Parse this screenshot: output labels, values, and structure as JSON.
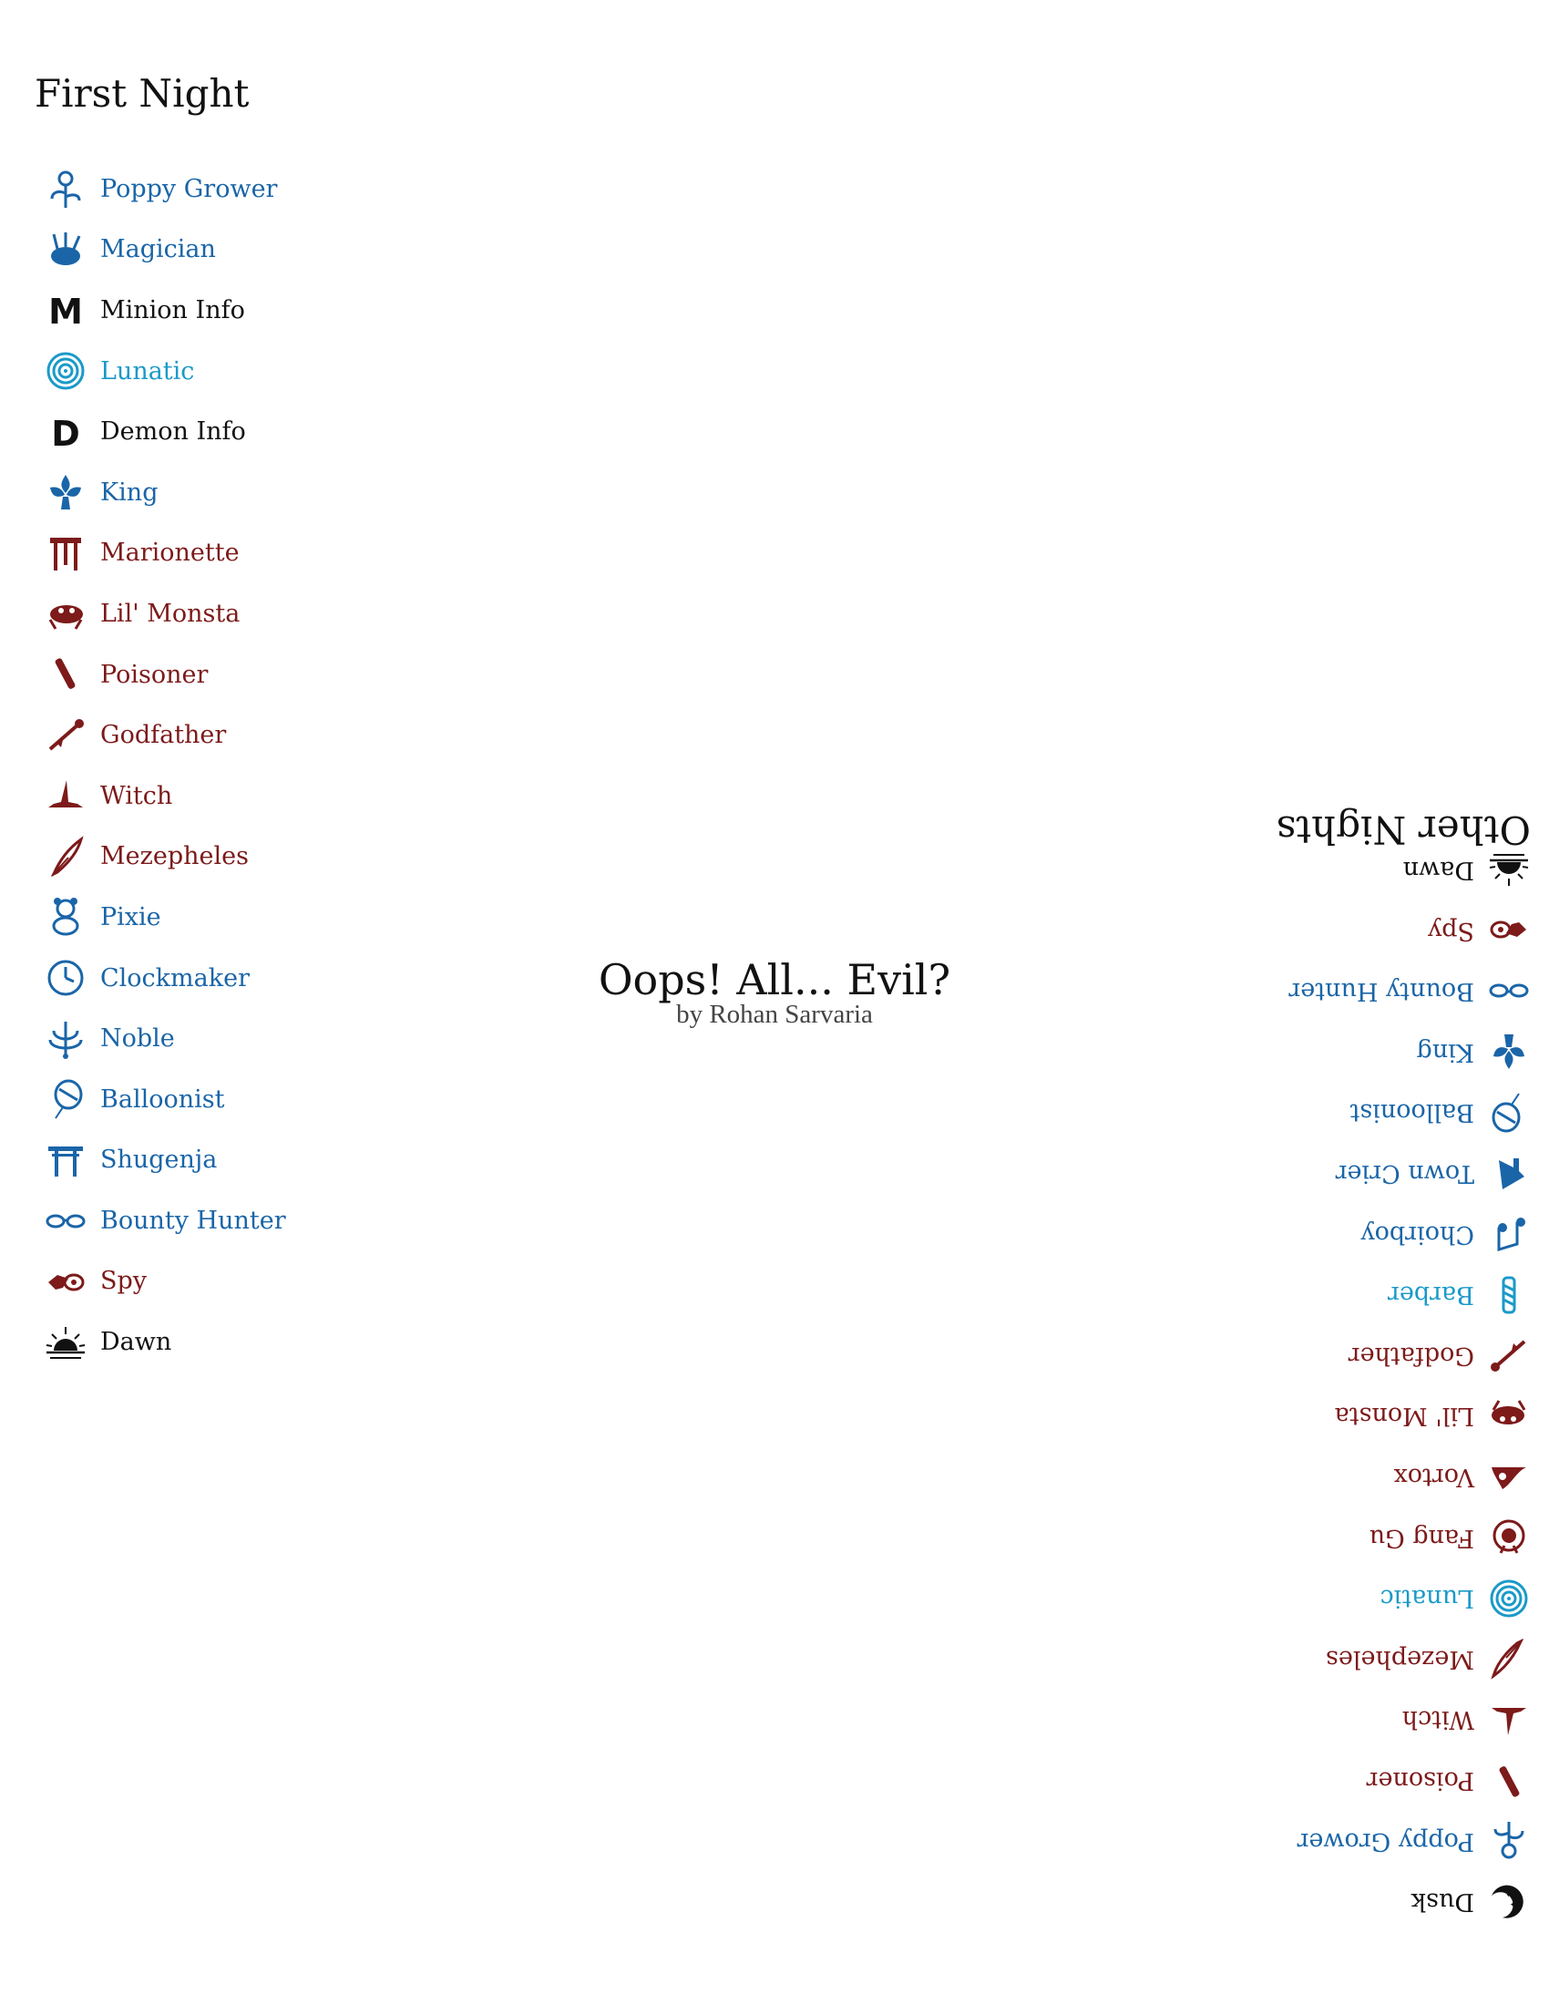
{
  "script": {
    "name": "Oops! All... Evil?",
    "author": "by Rohan Sarvaria"
  },
  "first_night": {
    "title": "First Night",
    "items": [
      {
        "label": "Poppy Grower",
        "team": "good",
        "icon": "poppy-grower-icon"
      },
      {
        "label": "Magician",
        "team": "good",
        "icon": "magician-icon"
      },
      {
        "label": "Minion Info",
        "team": "info",
        "icon": "minion-info-icon"
      },
      {
        "label": "Lunatic",
        "team": "cyan",
        "icon": "lunatic-icon"
      },
      {
        "label": "Demon Info",
        "team": "info",
        "icon": "demon-info-icon"
      },
      {
        "label": "King",
        "team": "good",
        "icon": "king-icon"
      },
      {
        "label": "Marionette",
        "team": "evil",
        "icon": "marionette-icon"
      },
      {
        "label": "Lil' Monsta",
        "team": "evil",
        "icon": "lil-monsta-icon"
      },
      {
        "label": "Poisoner",
        "team": "evil",
        "icon": "poisoner-icon"
      },
      {
        "label": "Godfather",
        "team": "evil",
        "icon": "godfather-icon"
      },
      {
        "label": "Witch",
        "team": "evil",
        "icon": "witch-icon"
      },
      {
        "label": "Mezepheles",
        "team": "evil",
        "icon": "mezepheles-icon"
      },
      {
        "label": "Pixie",
        "team": "good",
        "icon": "pixie-icon"
      },
      {
        "label": "Clockmaker",
        "team": "good",
        "icon": "clockmaker-icon"
      },
      {
        "label": "Noble",
        "team": "good",
        "icon": "noble-icon"
      },
      {
        "label": "Balloonist",
        "team": "good",
        "icon": "balloonist-icon"
      },
      {
        "label": "Shugenja",
        "team": "good",
        "icon": "shugenja-icon"
      },
      {
        "label": "Bounty Hunter",
        "team": "good",
        "icon": "bounty-hunter-icon"
      },
      {
        "label": "Spy",
        "team": "evil",
        "icon": "spy-icon"
      },
      {
        "label": "Dawn",
        "team": "info",
        "icon": "dawn-icon"
      }
    ]
  },
  "other_nights": {
    "title": "Other Nights",
    "items": [
      {
        "label": "Dusk",
        "team": "info",
        "icon": "dusk-icon"
      },
      {
        "label": "Poppy Grower",
        "team": "good",
        "icon": "poppy-grower-icon"
      },
      {
        "label": "Poisoner",
        "team": "evil",
        "icon": "poisoner-icon"
      },
      {
        "label": "Witch",
        "team": "evil",
        "icon": "witch-icon"
      },
      {
        "label": "Mezephеles",
        "team": "evil",
        "icon": "mezepheles-icon"
      },
      {
        "label": "Lunatic",
        "team": "cyan",
        "icon": "lunatic-icon"
      },
      {
        "label": "Fang Gu",
        "team": "evil",
        "icon": "fang-gu-icon"
      },
      {
        "label": "Vortox",
        "team": "evil",
        "icon": "vortox-icon"
      },
      {
        "label": "Lil' Monsta",
        "team": "evil",
        "icon": "lil-monsta-icon"
      },
      {
        "label": "Godfather",
        "team": "evil",
        "icon": "godfather-icon"
      },
      {
        "label": "Barber",
        "team": "cyan",
        "icon": "barber-icon"
      },
      {
        "label": "Choirboy",
        "team": "good",
        "icon": "choirboy-icon"
      },
      {
        "label": "Town Crier",
        "team": "good",
        "icon": "town-crier-icon"
      },
      {
        "label": "Balloonist",
        "team": "good",
        "icon": "balloonist-icon"
      },
      {
        "label": "King",
        "team": "good",
        "icon": "king-icon"
      },
      {
        "label": "Bounty Hunter",
        "team": "good",
        "icon": "bounty-hunter-icon"
      },
      {
        "label": "Spy",
        "team": "evil",
        "icon": "spy-icon"
      },
      {
        "label": "Dawn",
        "team": "info",
        "icon": "dawn-icon"
      }
    ]
  },
  "colors": {
    "good": "#1a65a8",
    "evil": "#7d1a1a",
    "info": "#111111",
    "cyan": "#1a9ac9"
  }
}
